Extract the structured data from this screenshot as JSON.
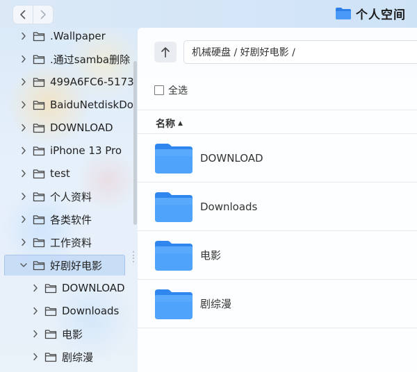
{
  "window": {
    "title": "个人空间",
    "title_icon": "folder-icon",
    "back_icon": "chevron-left-icon",
    "forward_icon": "chevron-right-icon"
  },
  "sidebar": {
    "items": [
      {
        "label": ".Wallpaper",
        "level": 0,
        "expanded": false
      },
      {
        "label": ".通过samba删除",
        "level": 0,
        "expanded": false
      },
      {
        "label": "499A6FC6-5173",
        "level": 0,
        "expanded": false
      },
      {
        "label": "BaiduNetdiskDo",
        "level": 0,
        "expanded": false
      },
      {
        "label": "DOWNLOAD",
        "level": 0,
        "expanded": false
      },
      {
        "label": "iPhone 13 Pro",
        "level": 0,
        "expanded": false
      },
      {
        "label": "test",
        "level": 0,
        "expanded": false
      },
      {
        "label": "个人资料",
        "level": 0,
        "expanded": false
      },
      {
        "label": "各类软件",
        "level": 0,
        "expanded": false
      },
      {
        "label": "工作资料",
        "level": 0,
        "expanded": false
      },
      {
        "label": "好剧好电影",
        "level": 0,
        "expanded": true,
        "selected": true
      },
      {
        "label": "DOWNLOAD",
        "level": 1,
        "expanded": false
      },
      {
        "label": "Downloads",
        "level": 1,
        "expanded": false
      },
      {
        "label": "电影",
        "level": 1,
        "expanded": false
      },
      {
        "label": "剧综漫",
        "level": 1,
        "expanded": false
      }
    ]
  },
  "main": {
    "up_icon": "arrow-up-icon",
    "path": "机械硬盘 / 好剧好电影 /",
    "select_all_label": "全选",
    "column_name": "名称",
    "sort_direction": "ascending",
    "files": [
      {
        "name": "DOWNLOAD",
        "type": "folder"
      },
      {
        "name": "Downloads",
        "type": "folder"
      },
      {
        "name": "电影",
        "type": "folder"
      },
      {
        "name": "剧综漫",
        "type": "folder"
      }
    ]
  },
  "colors": {
    "folder_blue": "#3d8ff5",
    "selection_bg": "#bed7f5"
  }
}
